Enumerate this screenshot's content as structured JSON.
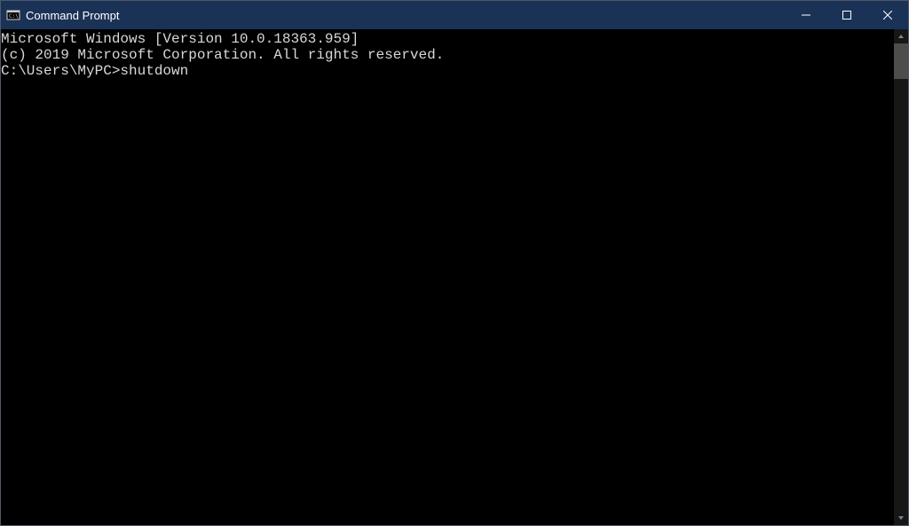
{
  "window": {
    "title": "Command Prompt"
  },
  "terminal": {
    "line1": "Microsoft Windows [Version 10.0.18363.959]",
    "line2": "(c) 2019 Microsoft Corporation. All rights reserved.",
    "blank": "",
    "prompt": "C:\\Users\\MyPC>",
    "command": "shutdown"
  }
}
